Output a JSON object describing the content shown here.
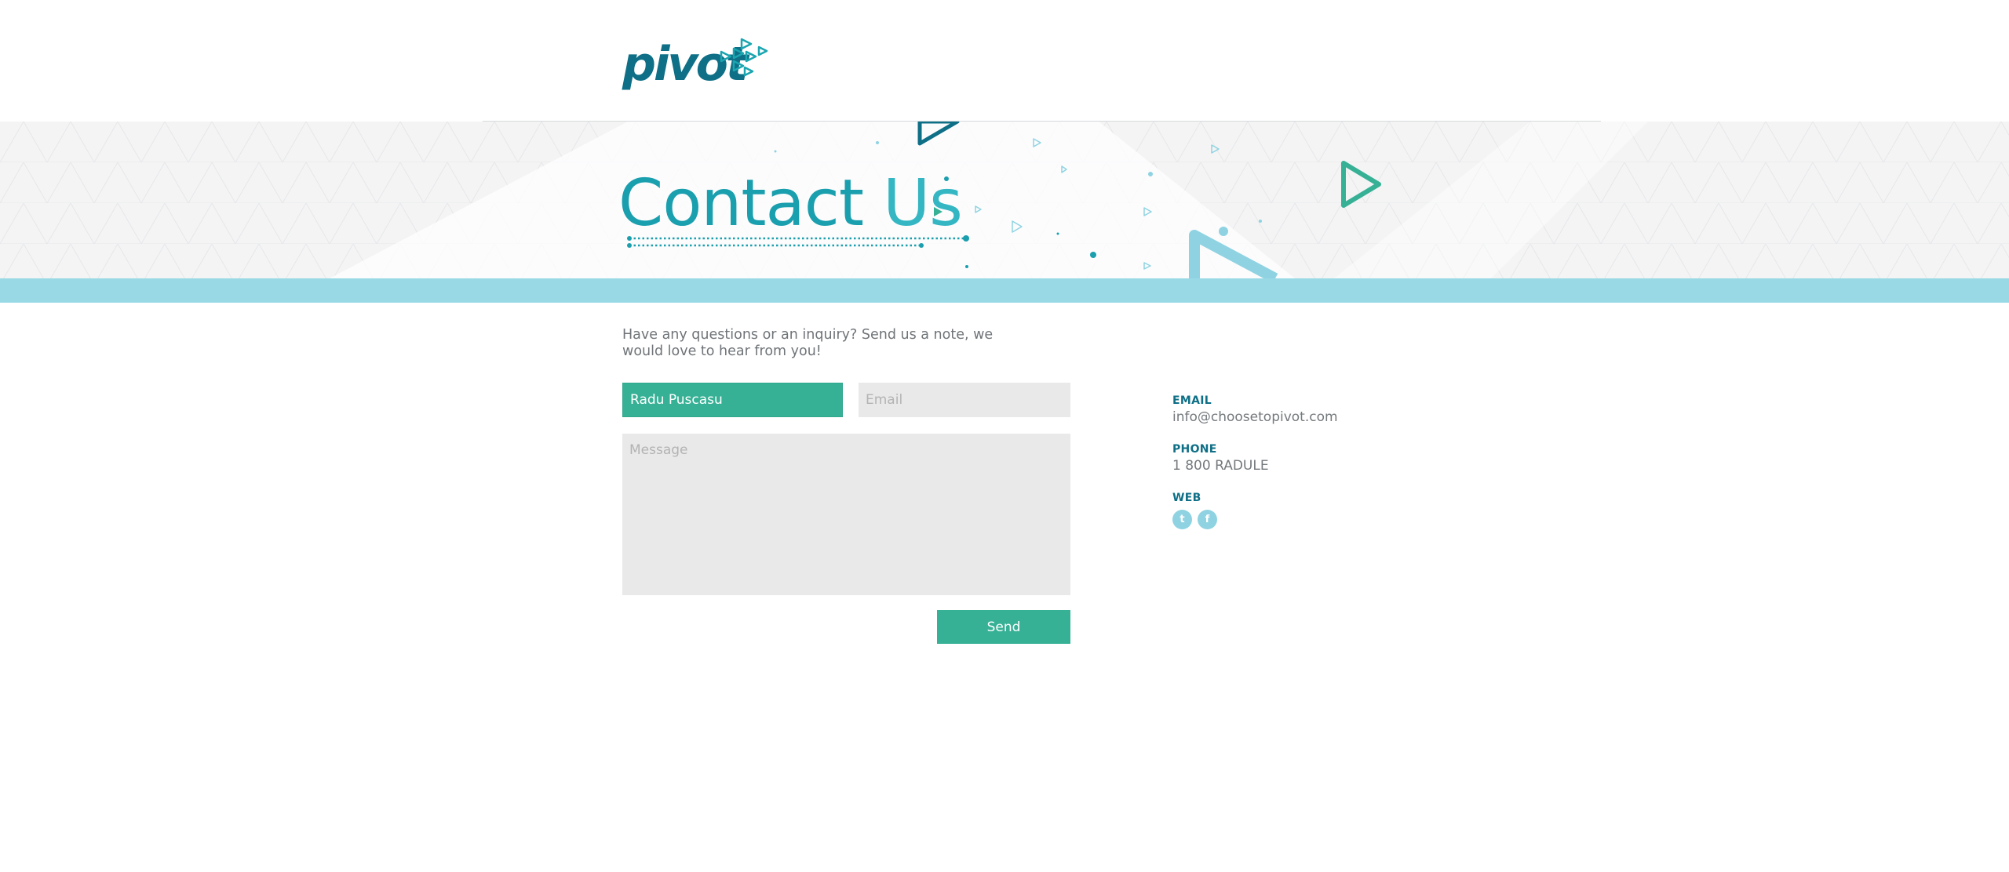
{
  "brand": {
    "logo_text": "pivot"
  },
  "hero": {
    "title_strong": "Contact",
    "title_light": "Us"
  },
  "intro": {
    "text": "Have any questions or an inquiry? Send us a note, we would love to hear from you!"
  },
  "form": {
    "name_value": "Radu Puscasu",
    "email_placeholder": "Email",
    "message_placeholder": "Message",
    "send_label": "Send"
  },
  "contact": {
    "email_label": "EMAIL",
    "email_value": "info@choosetopivot.com",
    "phone_label": "PHONE",
    "phone_value": "1 800 RADULE",
    "web_label": "WEB",
    "social": [
      {
        "glyph": "t",
        "icon": "twitter-icon"
      },
      {
        "glyph": "f",
        "icon": "facebook-icon"
      }
    ]
  },
  "colors": {
    "brand_dark": "#0e6f86",
    "brand_teal": "#1a9fae",
    "accent_green": "#36b195",
    "band_blue": "#99d9e6"
  }
}
